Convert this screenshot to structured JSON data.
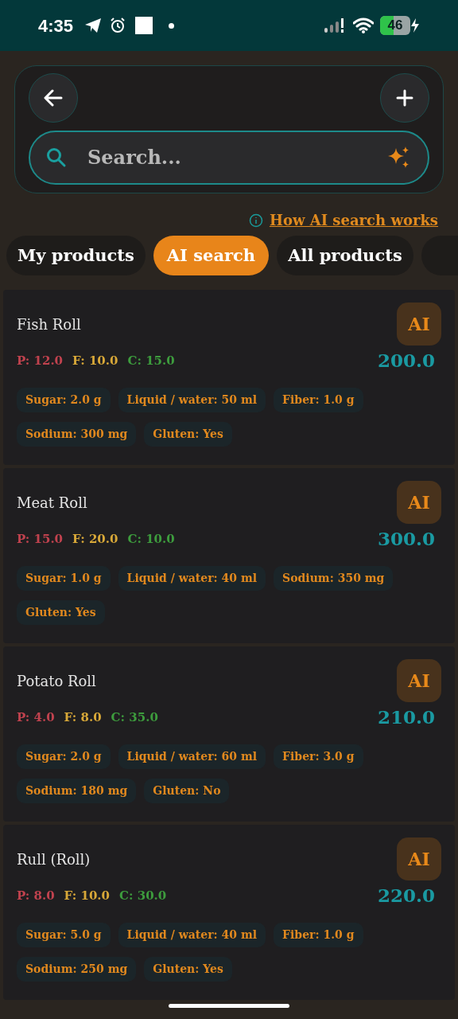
{
  "status_bar": {
    "time": "4:35",
    "battery": "46"
  },
  "search": {
    "placeholder": "Search..."
  },
  "info_link": "How AI search works",
  "tabs": [
    {
      "label": "My products",
      "selected": false
    },
    {
      "label": "AI search",
      "selected": true
    },
    {
      "label": "All products",
      "selected": false
    }
  ],
  "products": [
    {
      "name": "Fish Roll",
      "badge": "AI",
      "protein": "P: 12.0",
      "fat": "F: 10.0",
      "carbs": "C: 15.0",
      "calories": "200.0",
      "tags": [
        "Sugar: 2.0 g",
        "Liquid / water: 50 ml",
        "Fiber: 1.0 g",
        "Sodium: 300 mg",
        "Gluten: Yes"
      ]
    },
    {
      "name": "Meat Roll",
      "badge": "AI",
      "protein": "P: 15.0",
      "fat": "F: 20.0",
      "carbs": "C: 10.0",
      "calories": "300.0",
      "tags": [
        "Sugar: 1.0 g",
        "Liquid / water: 40 ml",
        "Sodium: 350 mg",
        "Gluten: Yes"
      ]
    },
    {
      "name": "Potato Roll",
      "badge": "AI",
      "protein": "P: 4.0",
      "fat": "F: 8.0",
      "carbs": "C: 35.0",
      "calories": "210.0",
      "tags": [
        "Sugar: 2.0 g",
        "Liquid / water: 60 ml",
        "Fiber: 3.0 g",
        "Sodium: 180 mg",
        "Gluten: No"
      ]
    },
    {
      "name": "Rull (Roll)",
      "badge": "AI",
      "protein": "P: 8.0",
      "fat": "F: 10.0",
      "carbs": "C: 30.0",
      "calories": "220.0",
      "tags": [
        "Sugar: 5.0 g",
        "Liquid / water: 40 ml",
        "Fiber: 1.0 g",
        "Sodium: 250 mg",
        "Gluten: Yes"
      ]
    }
  ]
}
